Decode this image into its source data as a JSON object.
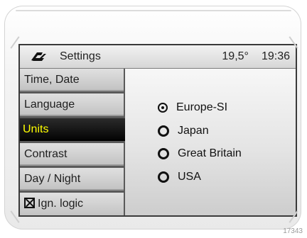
{
  "header": {
    "title": "Settings",
    "temperature": "19,5°",
    "time": "19:36",
    "logo_icon": "car-logo-icon"
  },
  "sidebar": {
    "items": [
      {
        "label": "Time, Date"
      },
      {
        "label": "Language"
      },
      {
        "label": "Units",
        "active": true
      },
      {
        "label": "Contrast"
      },
      {
        "label": "Day / Night"
      },
      {
        "label": "Ign. logic",
        "checkbox": true
      }
    ]
  },
  "units": {
    "options": [
      {
        "label": "Europe-SI",
        "selected": true
      },
      {
        "label": "Japan"
      },
      {
        "label": "Great Britain"
      },
      {
        "label": "USA"
      }
    ]
  },
  "reference_number": "17343",
  "colors": {
    "active_text": "#ffff00",
    "active_background": "#000000"
  }
}
